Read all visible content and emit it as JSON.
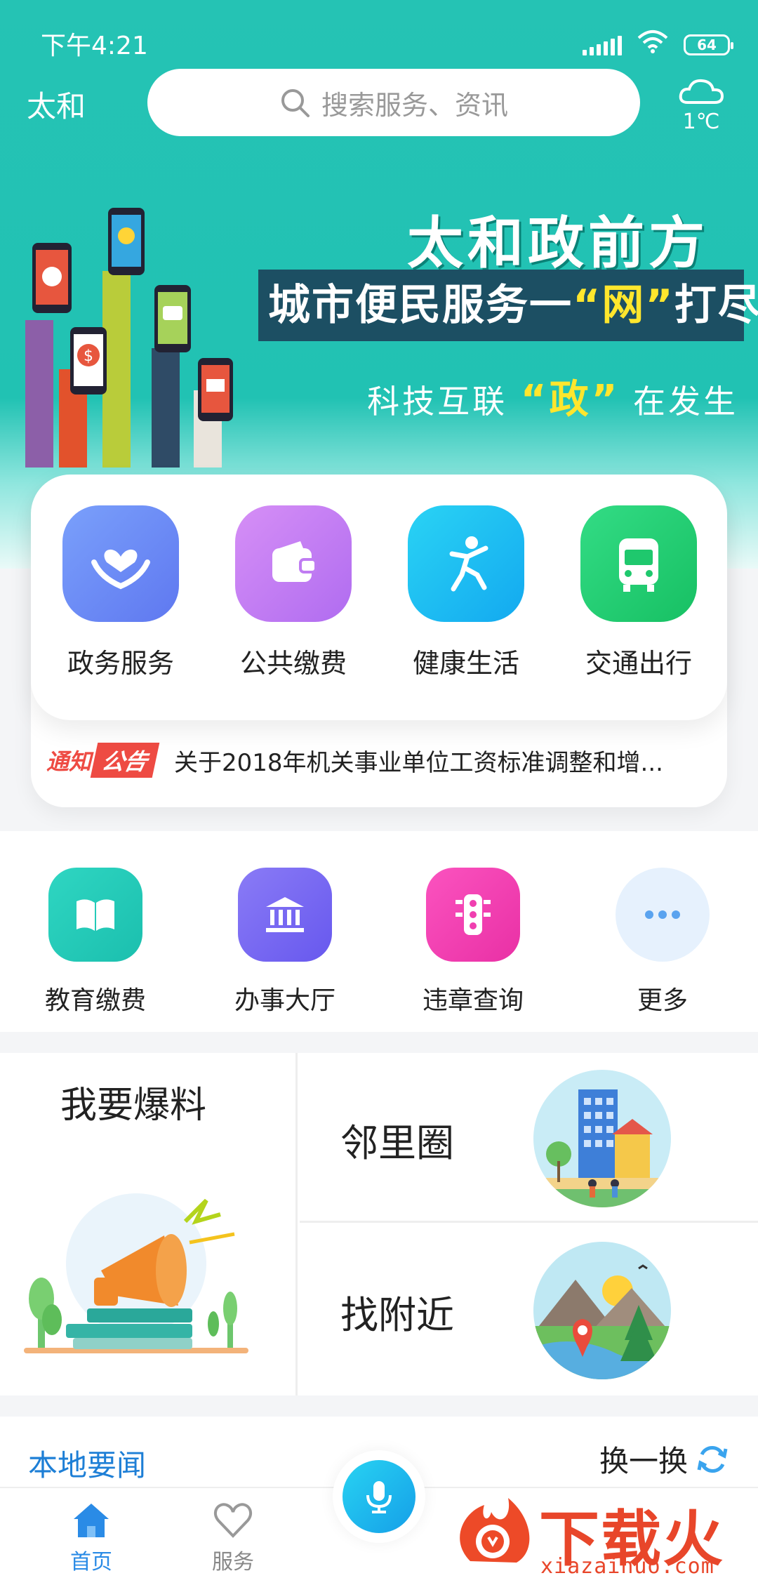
{
  "status_bar": {
    "time": "下午4:21",
    "battery": "64"
  },
  "header": {
    "city": "太和",
    "search_placeholder": "搜索服务、资讯",
    "temperature": "1℃"
  },
  "banner": {
    "title": "太和政前方",
    "bar_pre": "城市便民服务一",
    "bar_hl": "“网”",
    "bar_post": "打尽",
    "sub_pre": "科技互联",
    "sub_hl": "“政”",
    "sub_post": "在发生"
  },
  "quick_services": [
    {
      "label": "政务服务",
      "icon": "hands-heart-icon",
      "color": "#6f8cf7"
    },
    {
      "label": "公共缴费",
      "icon": "wallet-icon",
      "color": "#c77ff2"
    },
    {
      "label": "健康生活",
      "icon": "running-person-icon",
      "color": "#1bc3f4"
    },
    {
      "label": "交通出行",
      "icon": "bus-icon",
      "color": "#22cf75"
    }
  ],
  "notice": {
    "tag_left": "通知",
    "tag_right": "公告",
    "text": "关于2018年机关事业单位工资标准调整和增..."
  },
  "services": [
    {
      "label": "教育缴费",
      "icon": "book-icon",
      "color": "#22c9b8"
    },
    {
      "label": "办事大厅",
      "icon": "bank-building-icon",
      "color": "#7b6bf3"
    },
    {
      "label": "违章查询",
      "icon": "traffic-light-icon",
      "color": "#f244b3"
    },
    {
      "label": "更多",
      "icon": "more-dots-icon",
      "color": "#e6f1fd"
    }
  ],
  "features": {
    "report": "我要爆料",
    "neighbors": "邻里圈",
    "nearby": "找附近"
  },
  "news": {
    "title": "本地要闻",
    "refresh": "换一换"
  },
  "nav": {
    "home": "首页",
    "services": "服务"
  },
  "watermark": {
    "cn": "下载火",
    "en": "xiazaihuo.com"
  }
}
